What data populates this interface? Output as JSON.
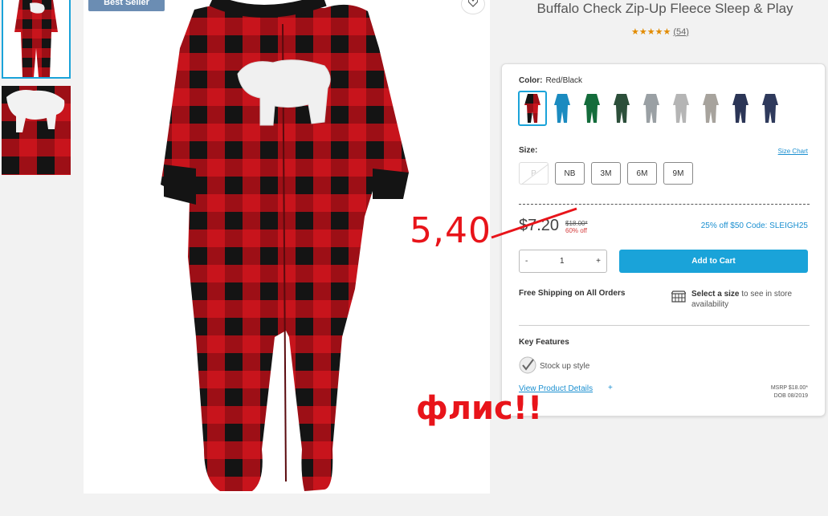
{
  "badge": "Best Seller",
  "product": {
    "title": "Buffalo Check Zip-Up Fleece Sleep & Play",
    "stars": "★★★★★",
    "rating_count": "(54)"
  },
  "color": {
    "label": "Color:",
    "value": "Red/Black",
    "swatches": [
      {
        "name": "red-black-check",
        "color": "#a7151d",
        "selected": true
      },
      {
        "name": "blue",
        "color": "#1b8bc0"
      },
      {
        "name": "green",
        "color": "#146c3b"
      },
      {
        "name": "green-stripe",
        "color": "#2c4f3a"
      },
      {
        "name": "grey-stripe",
        "color": "#9aa0a4"
      },
      {
        "name": "grey-white-stripe",
        "color": "#b5b5b5"
      },
      {
        "name": "grey-print",
        "color": "#a7a39d"
      },
      {
        "name": "navy",
        "color": "#2b3556"
      },
      {
        "name": "navy-print",
        "color": "#2f3a5c"
      }
    ]
  },
  "size": {
    "label": "Size:",
    "chart_link": "Size Chart",
    "options": [
      "P",
      "NB",
      "3M",
      "6M",
      "9M"
    ]
  },
  "pricing": {
    "price": "$7.20",
    "original": "$18.00*",
    "discount": "60% off",
    "promo": "25% off $50 Code: SLEIGH25"
  },
  "cart": {
    "minus": "-",
    "qty": "1",
    "plus": "+",
    "add_label": "Add to Cart"
  },
  "shipping": {
    "free": "Free Shipping on All Orders",
    "store_bold": "Select a size",
    "store_rest": " to see in store availability"
  },
  "features": {
    "heading": "Key Features",
    "items": [
      "Stock up style"
    ],
    "details_link": "View Product Details",
    "details_plus": "+",
    "msrp": "MSRP $18.00*",
    "dob": "DOB 08/2019"
  },
  "annotations": {
    "new_price": "5,40",
    "note": "флис!!",
    "color": "#e8141a"
  },
  "colors": {
    "accent": "#1aa3d9",
    "link": "#1a8fd0",
    "plaid_red": "#c8141c",
    "plaid_black": "#141414"
  }
}
